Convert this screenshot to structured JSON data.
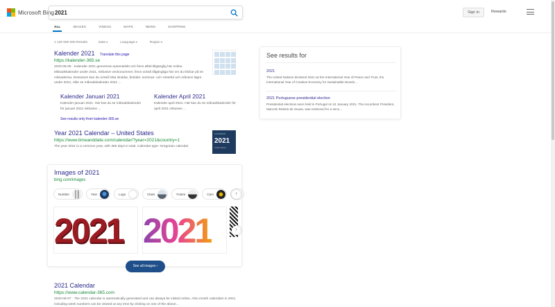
{
  "header": {
    "logo_text": "Microsoft Bing",
    "logo_colors": [
      "#f25022",
      "#7fba00",
      "#00a4ef",
      "#ffb900"
    ],
    "search_value": "2021",
    "signin_label": "Sign in",
    "rewards_label": "Rewards"
  },
  "tabs": [
    "ALL",
    "IMAGES",
    "VIDEOS",
    "MAPS",
    "NEWS",
    "SHOPPING"
  ],
  "filters": {
    "count": "1 120 000 000 Results",
    "date": "Date",
    "language": "Language",
    "region": "Region"
  },
  "results": [
    {
      "title": "Kalender 2021",
      "translate": "Translate this page",
      "url": "https://kalender-365.se",
      "snippet": "2020-06-08 · Kalender 2021 genereras automatiskt och finns alltid tillgänglig här online. Månadskalender under 2021, inklusive veckonummer, finns också tillgängliga här om du klickar på en månadsrina. Dessutom kan du också hitta skoldar, årstider, sommar- och vintertid och månens lägre under 2021, eller se månadskalender 2021 ..."
    },
    {
      "title": "Year 2021 Calendar – United States",
      "url": "https://www.timeanddate.com/calendar/?year=2021&country=1",
      "snippet": "The year 2021 is a common year, with 365 days in total. Calendar type: Gregorian calendar"
    },
    {
      "title": "2021 Calendar",
      "url": "https://www.calendar-365.com",
      "snippet": "2020-06-07 · The 2021 calendar is automatically generated and can always be visited online. Also month calendars in 2021 including week numbers can be viewed at any time by clicking on one of the above..."
    }
  ],
  "deeplinks": [
    {
      "title": "Kalender Januari 2021",
      "snippet": "Kalender januari 2021. Här kan du se månadskalender för januari 2021 inklusive ..."
    },
    {
      "title": "Kalender April 2021",
      "snippet": "Kalender april 2021. Här kan du se månadskalender för april 2021 inklusive ..."
    }
  ],
  "see_results_only": "See results only from kalender-365.se",
  "thumb": {
    "tag": "CALENDAR",
    "big": "2021",
    "sub": "United States"
  },
  "images_card": {
    "title": "Images of 2021",
    "url": "bing.com/images",
    "chips": [
      {
        "label": "Number",
        "color": "#bdbdbd"
      },
      {
        "label": "Year",
        "color": "#1e3a5f"
      },
      {
        "label": "Logo",
        "color": "#222222"
      },
      {
        "label": "Class",
        "color": "#8a9099"
      },
      {
        "label": "Future",
        "color": "#444444"
      },
      {
        "label": "Cars",
        "color": "#222222"
      },
      {
        "label": "C",
        "color": "#3a3a3a"
      }
    ],
    "digits": "2021",
    "see_all": "See all images"
  },
  "sidebar": {
    "title": "See results for",
    "items": [
      {
        "title": "2021",
        "desc": "The United Nations declared 2021 as the International Year of Peace and Trust, the International Year of Creative Economy for Sustainable Develo..."
      },
      {
        "title": "2021 Portuguese presidential election",
        "desc": "Presidential elections were held in Portugal on 24 January 2021. The incumbent President, Marcelo Rebelo de Sousa, was reelected for a seco..."
      }
    ]
  },
  "colors": {
    "accent": "#0072c6",
    "link": "#2b2a8c",
    "url": "#1a8a3a",
    "button": "#1f4f8a"
  }
}
